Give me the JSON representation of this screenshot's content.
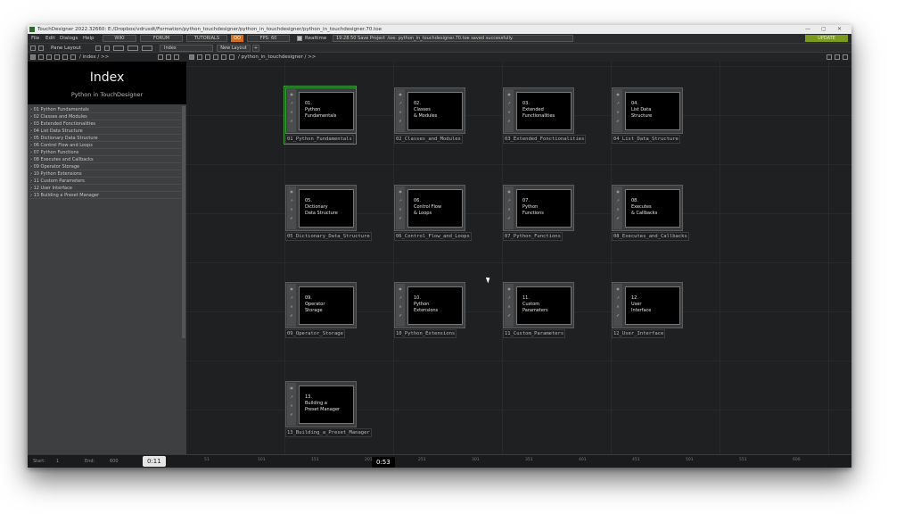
{
  "title_bar": {
    "text": "TouchDesigner 2022.32660: E:/Dropbox/vdrusdt/Formation/python_touchdesigner/python_in_touchdesigner/python_in_touchdesigner.70.toe",
    "minimize": "—",
    "maximize": "▢",
    "close": "✕"
  },
  "menubar": {
    "file": "File",
    "edit": "Edit",
    "dialogs": "Dialogs",
    "help": "Help",
    "wiki": "WIKI",
    "forum": "FORUM",
    "tutorials": "TUTORIALS",
    "oo": "OO",
    "fps": "FPS:  60",
    "realtime": "Realtime",
    "status_message": "19:28:50 Save Project .toe: python_in_touchdesigner.70.toe saved successfully.",
    "update": "UPDATE"
  },
  "pane_bar": {
    "pane_layout": "Pane Layout",
    "index_tab": "Index",
    "new_layout": "New Layout",
    "add": "+"
  },
  "left_path": "/ index / >>",
  "right_path": "/ python_in_touchdesigner / >>",
  "index_panel": {
    "title": "Index",
    "subtitle": "Python in TouchDesigner",
    "items": [
      "01 Python Fundamentals",
      "02 Classes and Modules",
      "03 Extended Fonctionalities",
      "04 List Data Structure",
      "05 Dictionary Data Structure",
      "06 Control Flow and Loops",
      "07 Python Functions",
      "08 Executes and Callbacks",
      "09 Operator Storage",
      "10 Python Extensions",
      "11 Custom Parameters",
      "12 User Interface",
      "13 Building a Preset Manager"
    ]
  },
  "nodes": [
    {
      "num": "01.",
      "line1": "Python",
      "line2": "Fundamentals",
      "caption": "01_Python_Fundamentals",
      "selected": true
    },
    {
      "num": "02.",
      "line1": "Classes",
      "line2": "& Modules",
      "caption": "02_Classes_and_Modules",
      "selected": false
    },
    {
      "num": "03.",
      "line1": "Extended",
      "line2": "Functionalities",
      "caption": "03_Extended_Fonctionalities",
      "selected": false
    },
    {
      "num": "04.",
      "line1": "List Data",
      "line2": "Structure",
      "caption": "04_List_Data_Structure",
      "selected": false
    },
    {
      "num": "05.",
      "line1": "Dictionary",
      "line2": "Data Structure",
      "caption": "05_Dictionary_Data_Structure",
      "selected": false
    },
    {
      "num": "06.",
      "line1": "Control Flow",
      "line2": "& Loops",
      "caption": "06_Control_Flow_and_Loops",
      "selected": false
    },
    {
      "num": "07.",
      "line1": "Python",
      "line2": "Functions",
      "caption": "07_Python_Functions",
      "selected": false
    },
    {
      "num": "08.",
      "line1": "Executes",
      "line2": "& Callbacks",
      "caption": "08_Executes_and_Callbacks",
      "selected": false
    },
    {
      "num": "09.",
      "line1": "Operator",
      "line2": "Storage",
      "caption": "09_Operator_Storage",
      "selected": false
    },
    {
      "num": "10.",
      "line1": "Python",
      "line2": "Extensions",
      "caption": "10_Python_Extensions",
      "selected": false
    },
    {
      "num": "11.",
      "line1": "Custom",
      "line2": "Parameters",
      "caption": "11_Custom_Parameters",
      "selected": false
    },
    {
      "num": "12.",
      "line1": "User",
      "line2": "Interface",
      "caption": "12_User_Interface",
      "selected": false
    },
    {
      "num": "13.",
      "line1": "Building a",
      "line2": "Preset Manager",
      "caption": "13_Building_a_Preset_Manager",
      "selected": false
    }
  ],
  "timeline": {
    "start_label": "Start:",
    "start_value": "1",
    "end_label": "End:",
    "end_value": "600",
    "ticks": [
      "51",
      "101",
      "151",
      "201",
      "251",
      "301",
      "351",
      "401",
      "451",
      "501",
      "551",
      "600"
    ]
  },
  "video_overlay": {
    "elapsed": "0:11",
    "hover_time": "0:53"
  },
  "colors": {
    "selection": "#3fa33f",
    "update_button": "#7a9a20",
    "canvas": "#1f2021"
  }
}
